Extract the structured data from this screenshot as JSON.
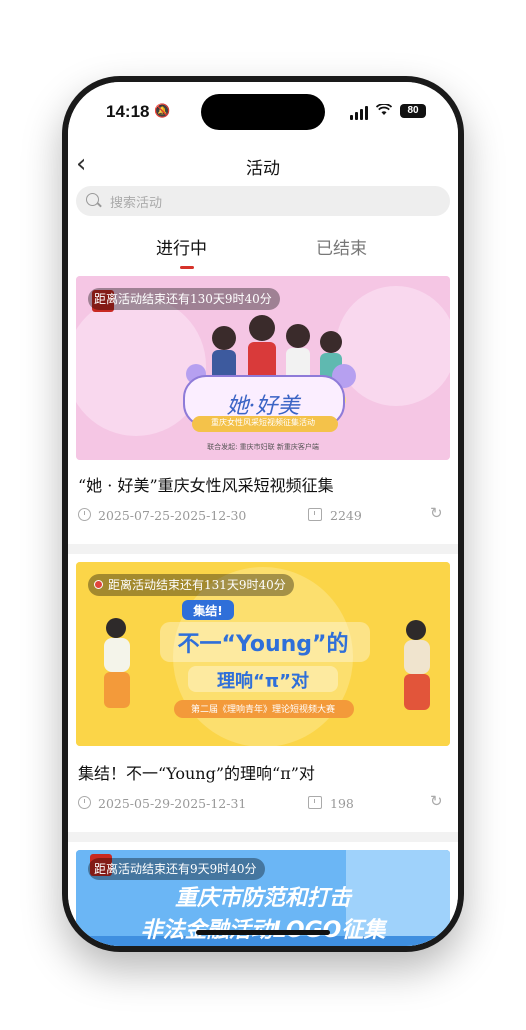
{
  "status_bar": {
    "time": "14:18",
    "battery": "80"
  },
  "nav": {
    "title": "活动"
  },
  "search": {
    "placeholder": "搜索活动"
  },
  "tabs": [
    {
      "label": "进行中",
      "active": true
    },
    {
      "label": "已结束",
      "active": false
    }
  ],
  "activities": [
    {
      "countdown": "距离活动结束还有130天9时40分",
      "title": "“她 · 好美”重庆女性风采短视频征集",
      "date_range": "2025-07-25-2025-12-30",
      "views": "2249",
      "banner": {
        "bg": "#f7c9e6",
        "headline": "她·好美",
        "subline": "重庆女性风采短视频征集活动",
        "org": "联合发起: 重庆市妇联  新重庆客户端"
      }
    },
    {
      "countdown": "距离活动结束还有131天9时40分",
      "title": "集结！不一“Young”的理响“π”对",
      "date_range": "2025-05-29-2025-12-31",
      "views": "198",
      "banner": {
        "bg": "#fbd548",
        "tag": "集结!",
        "line1": "不一“Young”的",
        "line2": "理响“π”对",
        "subline": "第二届《理响青年》理论短视频大赛"
      }
    },
    {
      "countdown": "距离活动结束还有9天9时40分",
      "banner": {
        "bg": "#5aa9f0",
        "line1": "重庆市防范和打击",
        "line2": "非法金融活动LOGO征集"
      }
    }
  ],
  "colors": {
    "accent": "#d6322a",
    "muted": "#999999"
  }
}
